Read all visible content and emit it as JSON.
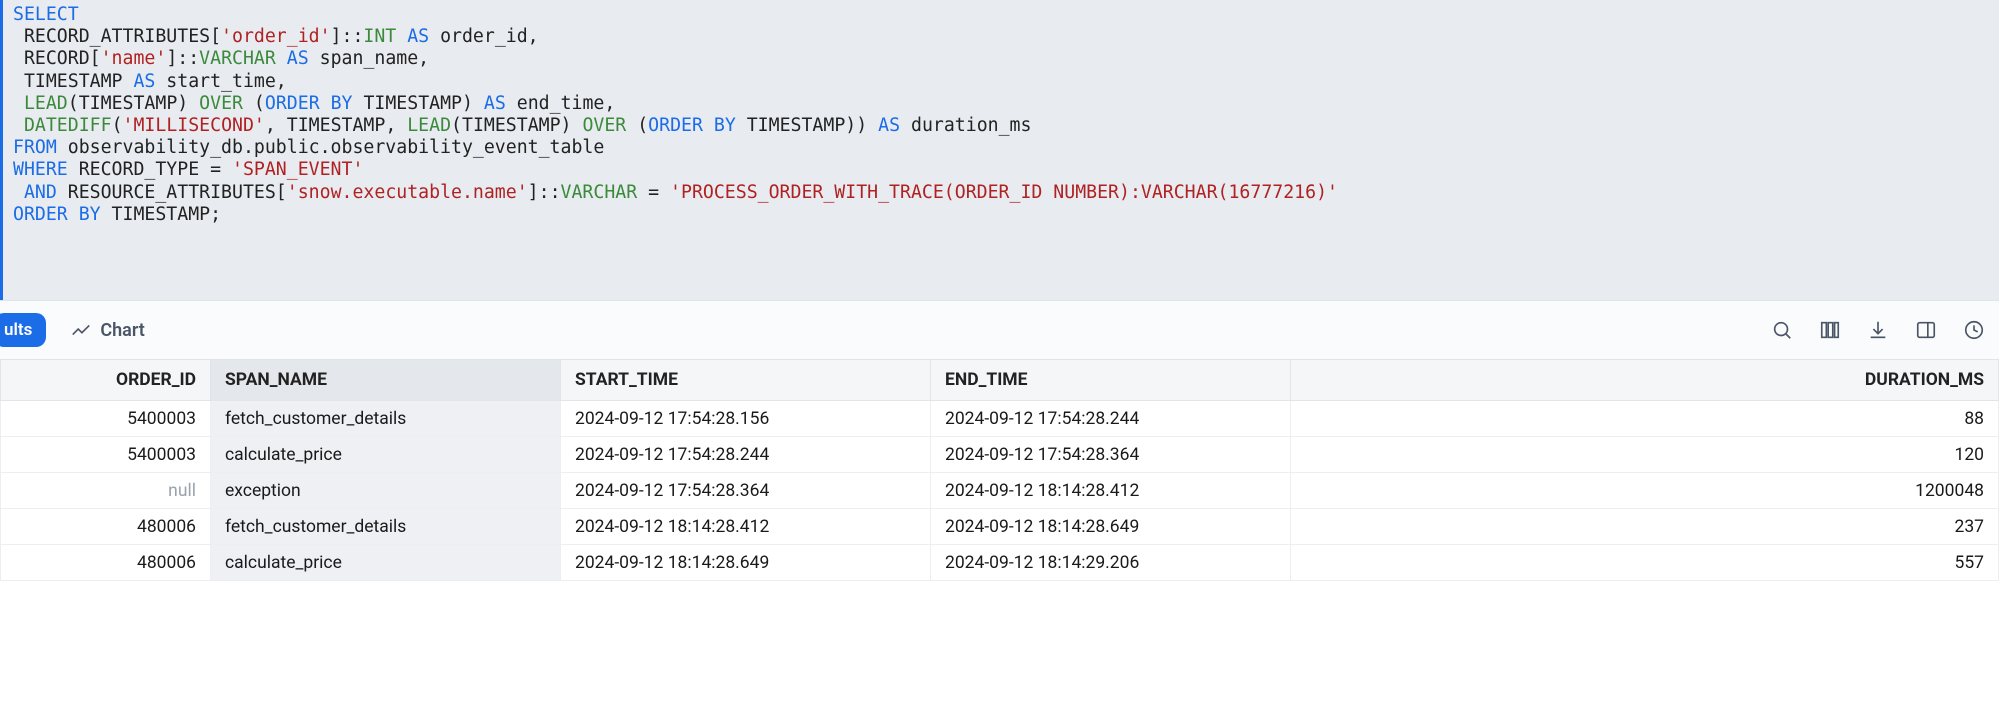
{
  "sql_tokens": [
    {
      "t": "SELECT",
      "c": "kw"
    },
    {
      "t": "\n RECORD_ATTRIBUTES[",
      "c": ""
    },
    {
      "t": "'order_id'",
      "c": "str"
    },
    {
      "t": "]",
      "c": ""
    },
    {
      "t": "::",
      "c": "punct"
    },
    {
      "t": "INT",
      "c": "type"
    },
    {
      "t": " ",
      "c": ""
    },
    {
      "t": "AS",
      "c": "kw"
    },
    {
      "t": " order_id,\n RECORD[",
      "c": ""
    },
    {
      "t": "'name'",
      "c": "str"
    },
    {
      "t": "]",
      "c": ""
    },
    {
      "t": "::",
      "c": "punct"
    },
    {
      "t": "VARCHAR",
      "c": "type"
    },
    {
      "t": " ",
      "c": ""
    },
    {
      "t": "AS",
      "c": "kw"
    },
    {
      "t": " span_name,\n TIMESTAMP ",
      "c": ""
    },
    {
      "t": "AS",
      "c": "kw"
    },
    {
      "t": " start_time,\n ",
      "c": ""
    },
    {
      "t": "LEAD",
      "c": "type"
    },
    {
      "t": "(TIMESTAMP) ",
      "c": ""
    },
    {
      "t": "OVER",
      "c": "type"
    },
    {
      "t": " (",
      "c": ""
    },
    {
      "t": "ORDER BY",
      "c": "kw"
    },
    {
      "t": " TIMESTAMP) ",
      "c": ""
    },
    {
      "t": "AS",
      "c": "kw"
    },
    {
      "t": " end_time,\n ",
      "c": ""
    },
    {
      "t": "DATEDIFF",
      "c": "type"
    },
    {
      "t": "(",
      "c": ""
    },
    {
      "t": "'MILLISECOND'",
      "c": "str"
    },
    {
      "t": ", TIMESTAMP, ",
      "c": ""
    },
    {
      "t": "LEAD",
      "c": "type"
    },
    {
      "t": "(TIMESTAMP) ",
      "c": ""
    },
    {
      "t": "OVER",
      "c": "type"
    },
    {
      "t": " (",
      "c": ""
    },
    {
      "t": "ORDER BY",
      "c": "kw"
    },
    {
      "t": " TIMESTAMP)) ",
      "c": ""
    },
    {
      "t": "AS",
      "c": "kw"
    },
    {
      "t": " duration_ms\n",
      "c": ""
    },
    {
      "t": "FROM",
      "c": "kw"
    },
    {
      "t": " observability_db.public.observability_event_table\n",
      "c": ""
    },
    {
      "t": "WHERE",
      "c": "kw"
    },
    {
      "t": " RECORD_TYPE = ",
      "c": ""
    },
    {
      "t": "'SPAN_EVENT'",
      "c": "str"
    },
    {
      "t": "\n ",
      "c": ""
    },
    {
      "t": "AND",
      "c": "kw"
    },
    {
      "t": " RESOURCE_ATTRIBUTES[",
      "c": ""
    },
    {
      "t": "'snow.executable.name'",
      "c": "str"
    },
    {
      "t": "]",
      "c": ""
    },
    {
      "t": "::",
      "c": "punct"
    },
    {
      "t": "VARCHAR",
      "c": "type"
    },
    {
      "t": " = ",
      "c": ""
    },
    {
      "t": "'PROCESS_ORDER_WITH_TRACE(ORDER_ID NUMBER):VARCHAR(16777216)'",
      "c": "str"
    },
    {
      "t": "\n",
      "c": ""
    },
    {
      "t": "ORDER BY",
      "c": "kw"
    },
    {
      "t": " TIMESTAMP;",
      "c": ""
    }
  ],
  "tabs": {
    "results": "ults",
    "chart": "Chart"
  },
  "columns": [
    {
      "key": "ORDER_ID",
      "label": "ORDER_ID",
      "align": "num"
    },
    {
      "key": "SPAN_NAME",
      "label": "SPAN_NAME",
      "align": "",
      "sel": true
    },
    {
      "key": "START_TIME",
      "label": "START_TIME",
      "align": ""
    },
    {
      "key": "END_TIME",
      "label": "END_TIME",
      "align": ""
    },
    {
      "key": "DURATION_MS",
      "label": "DURATION_MS",
      "align": "num"
    }
  ],
  "rows": [
    {
      "ORDER_ID": "5400003",
      "SPAN_NAME": "fetch_customer_details",
      "START_TIME": "2024-09-12 17:54:28.156",
      "END_TIME": "2024-09-12 17:54:28.244",
      "DURATION_MS": "88"
    },
    {
      "ORDER_ID": "5400003",
      "SPAN_NAME": "calculate_price",
      "START_TIME": "2024-09-12 17:54:28.244",
      "END_TIME": "2024-09-12 17:54:28.364",
      "DURATION_MS": "120"
    },
    {
      "ORDER_ID": null,
      "SPAN_NAME": "exception",
      "START_TIME": "2024-09-12 17:54:28.364",
      "END_TIME": "2024-09-12 18:14:28.412",
      "DURATION_MS": "1200048"
    },
    {
      "ORDER_ID": "480006",
      "SPAN_NAME": "fetch_customer_details",
      "START_TIME": "2024-09-12 18:14:28.412",
      "END_TIME": "2024-09-12 18:14:28.649",
      "DURATION_MS": "237"
    },
    {
      "ORDER_ID": "480006",
      "SPAN_NAME": "calculate_price",
      "START_TIME": "2024-09-12 18:14:28.649",
      "END_TIME": "2024-09-12 18:14:29.206",
      "DURATION_MS": "557"
    }
  ],
  "null_label": "null"
}
